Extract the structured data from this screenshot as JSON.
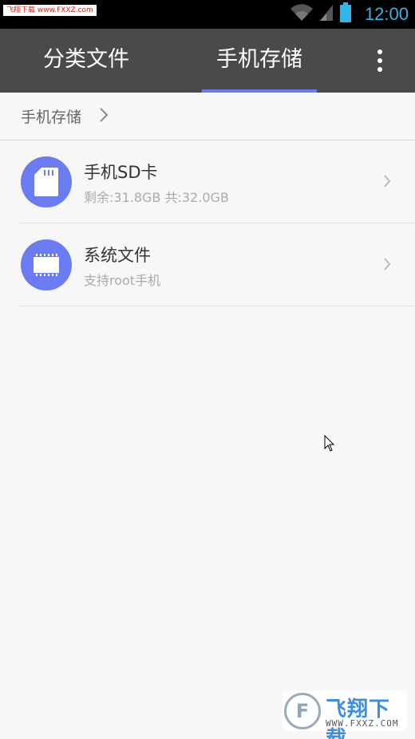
{
  "status_bar": {
    "watermark": "飞翔下载 www.FXXZ.com",
    "time": "12:00",
    "icons": [
      "wifi-icon",
      "signal-icon",
      "battery-icon"
    ]
  },
  "tabs": [
    {
      "label": "分类文件",
      "active": false
    },
    {
      "label": "手机存储",
      "active": true
    }
  ],
  "menu": {
    "icon": "more-vertical-icon"
  },
  "breadcrumb": {
    "label": "手机存储",
    "icon": "chevron-right-icon"
  },
  "items": [
    {
      "title": "手机SD卡",
      "subtitle": "剩余:31.8GB  共:32.0GB",
      "icon": "sd-card-icon"
    },
    {
      "title": "系统文件",
      "subtitle": "支持root手机",
      "icon": "chip-icon"
    }
  ],
  "colors": {
    "accent": "#6b7cf2",
    "tab_bar": "#4a4a4c",
    "status_time": "#33b5e5",
    "background": "#f7f7f7"
  },
  "watermark_bottom": {
    "text": "飞翔下载",
    "url": "WWW.FXXZ.COM"
  }
}
